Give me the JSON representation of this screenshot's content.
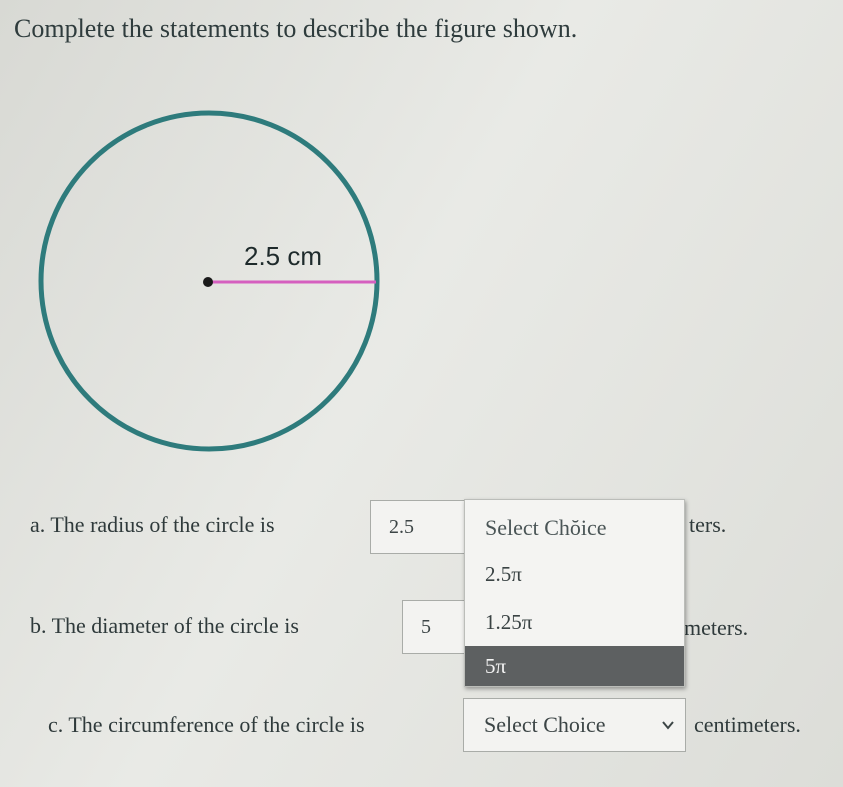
{
  "title": "Complete the statements to describe the figure shown.",
  "figure": {
    "radius_label": "2.5 cm",
    "colors": {
      "circle": "#2e7b7c",
      "radius": "#d55fbf",
      "center": "#1a1a1a"
    }
  },
  "statement_a": {
    "prefix": "a. The radius of the circle is",
    "value": "2.5",
    "suffix_partial": "ters."
  },
  "statement_b": {
    "prefix": "b. The diameter of the circle is",
    "value": "5",
    "suffix_partial": "meters."
  },
  "statement_c": {
    "prefix": "c. The circumference of the circle is",
    "select_label": "Select Choice",
    "suffix": "centimeters."
  },
  "dropdown": {
    "header": "Select Chŏice",
    "options": [
      "2.5π",
      "1.25π",
      "5π"
    ],
    "highlighted": "5π"
  }
}
